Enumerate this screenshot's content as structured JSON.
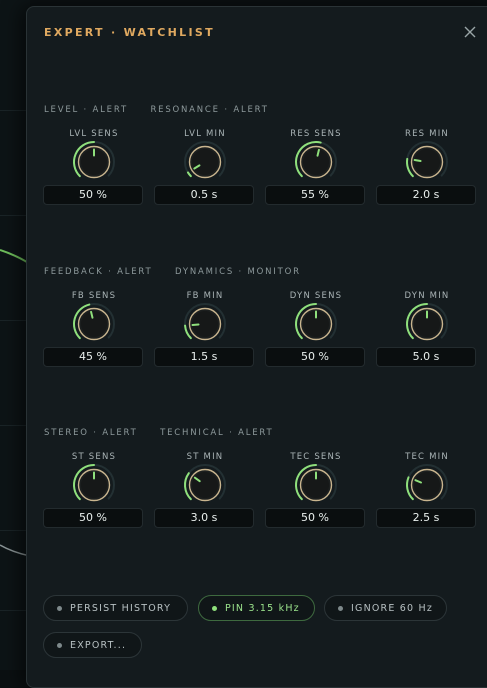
{
  "panel": {
    "title": "EXPERT · WATCHLIST",
    "close_icon": "close-icon"
  },
  "sections": [
    {
      "heading": "LEVEL · ALERT     RESONANCE · ALERT",
      "knobs": [
        {
          "label": "LVL SENS",
          "value": "50 %",
          "level": 0.5
        },
        {
          "label": "LVL MIN",
          "value": "0.5 s",
          "level": 0.05
        },
        {
          "label": "RES SENS",
          "value": "55 %",
          "level": 0.55
        },
        {
          "label": "RES MIN",
          "value": "2.0 s",
          "level": 0.2
        }
      ]
    },
    {
      "heading": "FEEDBACK · ALERT     DYNAMICS · MONITOR",
      "knobs": [
        {
          "label": "FB SENS",
          "value": "45 %",
          "level": 0.45
        },
        {
          "label": "FB MIN",
          "value": "1.5 s",
          "level": 0.15
        },
        {
          "label": "DYN SENS",
          "value": "50 %",
          "level": 0.5
        },
        {
          "label": "DYN MIN",
          "value": "5.0 s",
          "level": 0.5
        }
      ]
    },
    {
      "heading": "STEREO · ALERT     TECHNICAL · ALERT",
      "knobs": [
        {
          "label": "ST SENS",
          "value": "50 %",
          "level": 0.5
        },
        {
          "label": "ST MIN",
          "value": "3.0 s",
          "level": 0.3
        },
        {
          "label": "TEC SENS",
          "value": "50 %",
          "level": 0.5
        },
        {
          "label": "TEC MIN",
          "value": "2.5 s",
          "level": 0.25
        }
      ]
    }
  ],
  "buttons": [
    {
      "label": "PERSIST HISTORY",
      "active": false
    },
    {
      "label": "PIN 3.15 kHz",
      "active": true
    },
    {
      "label": "IGNORE 60 Hz",
      "active": false
    },
    {
      "label": "EXPORT..."
    }
  ],
  "colors": {
    "accent_title": "#e0a960",
    "knob_arc": "#8fe07c",
    "knob_ring": "#c9b58f",
    "active_green": "#9be38c"
  }
}
